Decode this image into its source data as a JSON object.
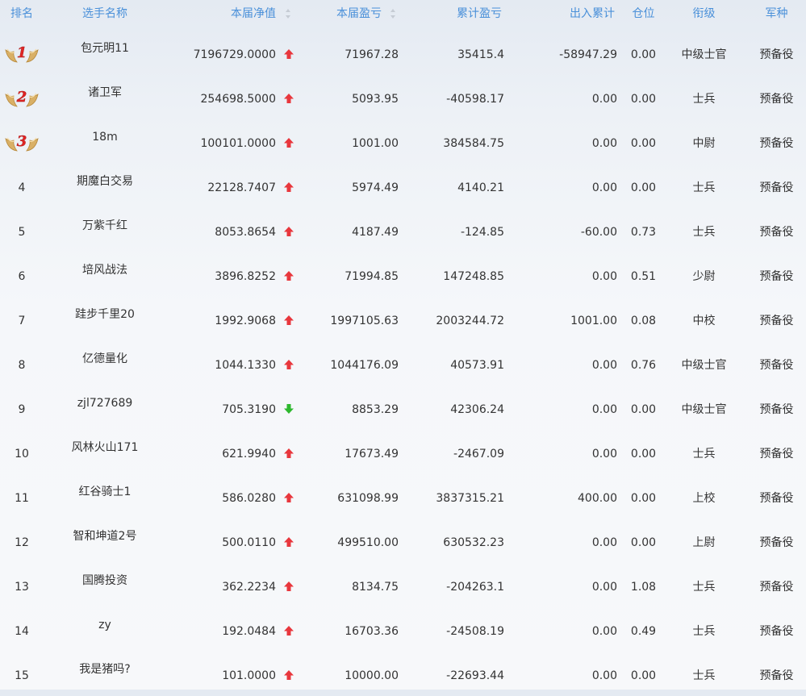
{
  "table": {
    "headers": {
      "rank": "排名",
      "name": "选手名称",
      "nav": "本届净值",
      "profit": "本届盈亏",
      "cumulative": "累计盈亏",
      "flow": "出入累计",
      "position": "仓位",
      "title": "衔级",
      "branch": "军种"
    },
    "rows": [
      {
        "rank": "1",
        "medal": true,
        "name": "包元明11",
        "nav": "7196729.0000",
        "trend": "up",
        "profit": "71967.28",
        "cumulative": "35415.4",
        "flow": "-58947.29",
        "position": "0.00",
        "title": "中级士官",
        "branch": "预备役"
      },
      {
        "rank": "2",
        "medal": true,
        "name": "诸卫军",
        "nav": "254698.5000",
        "trend": "up",
        "profit": "5093.95",
        "cumulative": "-40598.17",
        "flow": "0.00",
        "position": "0.00",
        "title": "士兵",
        "branch": "预备役"
      },
      {
        "rank": "3",
        "medal": true,
        "name": "18m",
        "nav": "100101.0000",
        "trend": "up",
        "profit": "1001.00",
        "cumulative": "384584.75",
        "flow": "0.00",
        "position": "0.00",
        "title": "中尉",
        "branch": "预备役"
      },
      {
        "rank": "4",
        "medal": false,
        "name": "期魔白交易",
        "nav": "22128.7407",
        "trend": "up",
        "profit": "5974.49",
        "cumulative": "4140.21",
        "flow": "0.00",
        "position": "0.00",
        "title": "士兵",
        "branch": "预备役"
      },
      {
        "rank": "5",
        "medal": false,
        "name": "万紫千红",
        "nav": "8053.8654",
        "trend": "up",
        "profit": "4187.49",
        "cumulative": "-124.85",
        "flow": "-60.00",
        "position": "0.73",
        "title": "士兵",
        "branch": "预备役"
      },
      {
        "rank": "6",
        "medal": false,
        "name": "培风战法",
        "nav": "3896.8252",
        "trend": "up",
        "profit": "71994.85",
        "cumulative": "147248.85",
        "flow": "0.00",
        "position": "0.51",
        "title": "少尉",
        "branch": "预备役"
      },
      {
        "rank": "7",
        "medal": false,
        "name": "跬步千里20",
        "nav": "1992.9068",
        "trend": "up",
        "profit": "1997105.63",
        "cumulative": "2003244.72",
        "flow": "1001.00",
        "position": "0.08",
        "title": "中校",
        "branch": "预备役"
      },
      {
        "rank": "8",
        "medal": false,
        "name": "亿德量化",
        "nav": "1044.1330",
        "trend": "up",
        "profit": "1044176.09",
        "cumulative": "40573.91",
        "flow": "0.00",
        "position": "0.76",
        "title": "中级士官",
        "branch": "预备役"
      },
      {
        "rank": "9",
        "medal": false,
        "name": "zjl727689",
        "nav": "705.3190",
        "trend": "down",
        "profit": "8853.29",
        "cumulative": "42306.24",
        "flow": "0.00",
        "position": "0.00",
        "title": "中级士官",
        "branch": "预备役"
      },
      {
        "rank": "10",
        "medal": false,
        "name": "风林火山171",
        "nav": "621.9940",
        "trend": "up",
        "profit": "17673.49",
        "cumulative": "-2467.09",
        "flow": "0.00",
        "position": "0.00",
        "title": "士兵",
        "branch": "预备役"
      },
      {
        "rank": "11",
        "medal": false,
        "name": "红谷骑士1",
        "nav": "586.0280",
        "trend": "up",
        "profit": "631098.99",
        "cumulative": "3837315.21",
        "flow": "400.00",
        "position": "0.00",
        "title": "上校",
        "branch": "预备役"
      },
      {
        "rank": "12",
        "medal": false,
        "name": "智和坤道2号",
        "nav": "500.0110",
        "trend": "up",
        "profit": "499510.00",
        "cumulative": "630532.23",
        "flow": "0.00",
        "position": "0.00",
        "title": "上尉",
        "branch": "预备役"
      },
      {
        "rank": "13",
        "medal": false,
        "name": "国腾投资",
        "nav": "362.2234",
        "trend": "up",
        "profit": "8134.75",
        "cumulative": "-204263.1",
        "flow": "0.00",
        "position": "1.08",
        "title": "士兵",
        "branch": "预备役"
      },
      {
        "rank": "14",
        "medal": false,
        "name": "zy",
        "nav": "192.0484",
        "trend": "up",
        "profit": "16703.36",
        "cumulative": "-24508.19",
        "flow": "0.00",
        "position": "0.49",
        "title": "士兵",
        "branch": "预备役"
      },
      {
        "rank": "15",
        "medal": false,
        "name": "我是猪吗?",
        "nav": "101.0000",
        "trend": "up",
        "profit": "10000.00",
        "cumulative": "-22693.44",
        "flow": "0.00",
        "position": "0.00",
        "title": "士兵",
        "branch": "预备役"
      }
    ]
  },
  "colors": {
    "header_text": "#4a90d9",
    "up_arrow": "#e8373d",
    "down_arrow": "#2eb82e",
    "medal_gold": "#d9b066",
    "medal_number": "#e02424"
  }
}
